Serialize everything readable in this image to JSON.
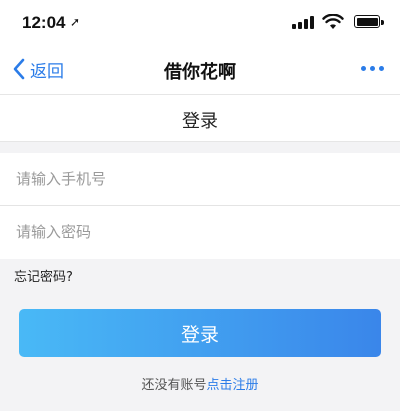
{
  "status_bar": {
    "time": "12:04",
    "location_arrow": "➚"
  },
  "nav": {
    "back_label": "返回",
    "title": "借你花啊"
  },
  "page": {
    "title": "登录"
  },
  "form": {
    "phone_placeholder": "请输入手机号",
    "password_placeholder": "请输入密码",
    "forgot_label": "忘记密码?",
    "submit_label": "登录"
  },
  "register": {
    "prompt": "还没有账号",
    "link_label": "点击注册"
  },
  "colors": {
    "accent": "#2b7ce8",
    "button_start": "#49b9f6",
    "button_end": "#3a86ea"
  },
  "icons": [
    "location-arrow-icon",
    "signal-icon",
    "wifi-icon",
    "battery-icon",
    "chevron-left-icon",
    "more-icon"
  ]
}
